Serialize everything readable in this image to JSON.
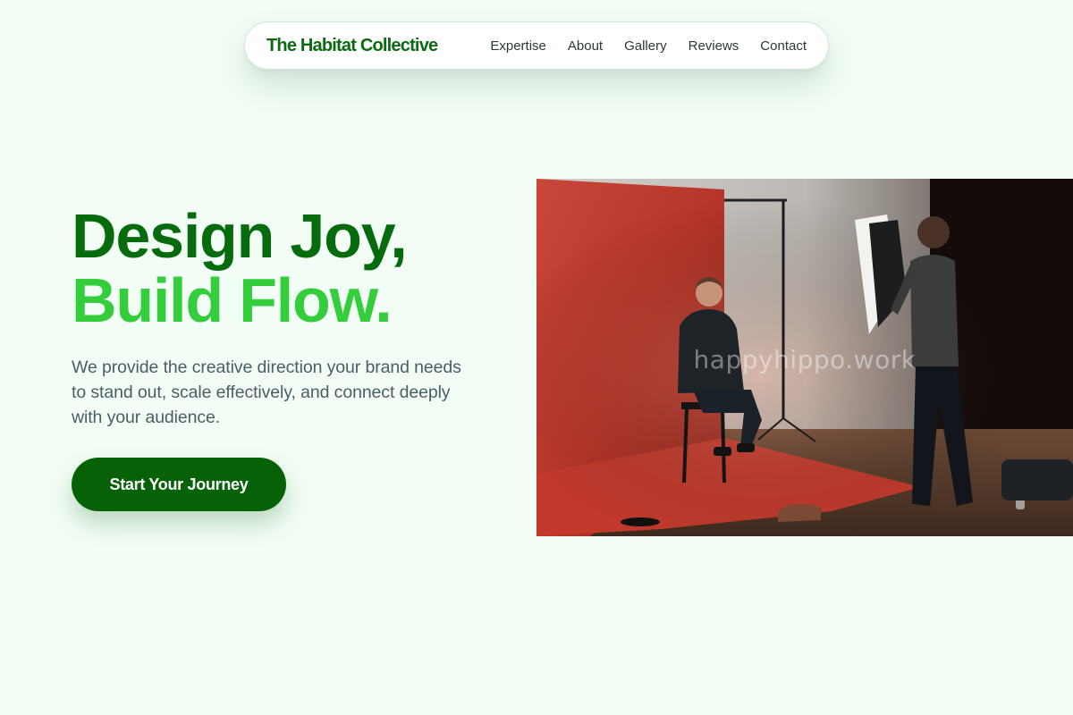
{
  "nav": {
    "brand": "The Habitat Collective",
    "links": [
      "Expertise",
      "About",
      "Gallery",
      "Reviews",
      "Contact"
    ]
  },
  "hero": {
    "headline_line1": "Design Joy,",
    "headline_line2": "Build Flow.",
    "description": "We provide the creative direction your brand needs to stand out, scale effectively, and connect deeply with your audience.",
    "cta_label": "Start Your Journey",
    "image_watermark": "happyhippo.work"
  },
  "colors": {
    "page_background": "#f2fdf5",
    "brand_dark_green": "#066b0c",
    "brand_bright_green": "#34cd3c",
    "cta_background": "#066107",
    "body_text": "#4d5c66"
  },
  "icons": {
    "hero_image": "photo-studio-portrait-scene"
  }
}
